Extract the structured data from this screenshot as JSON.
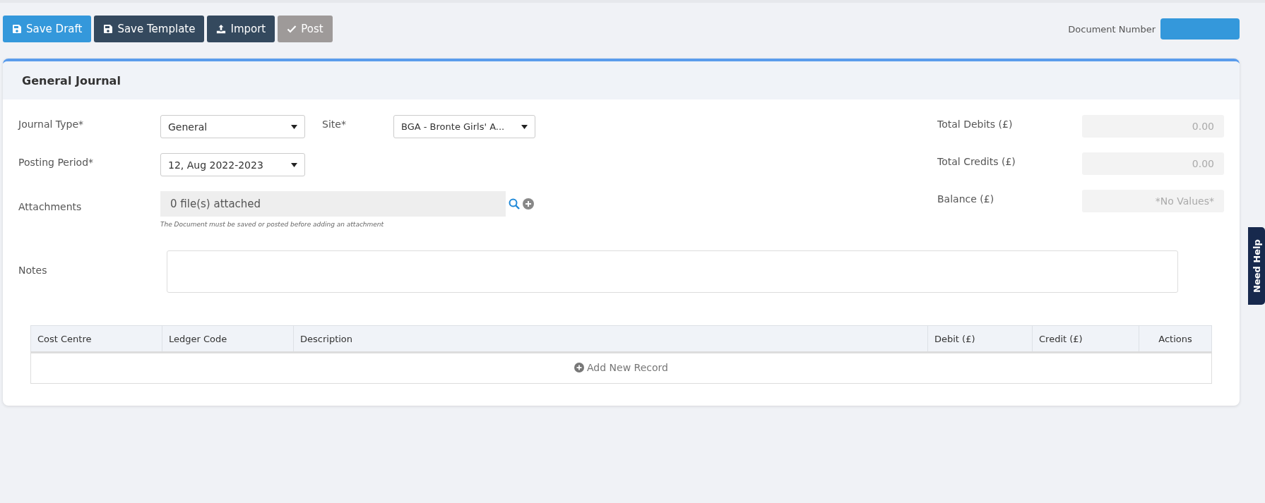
{
  "toolbar": {
    "buttons": [
      {
        "label": "Save Draft",
        "kind": "primary",
        "disabled": false
      },
      {
        "label": "Save Template",
        "kind": "dark",
        "disabled": false
      },
      {
        "label": "Import",
        "kind": "dark",
        "disabled": false
      },
      {
        "label": "Post",
        "kind": "dark",
        "disabled": true
      }
    ]
  },
  "document_number": {
    "label": "Document Number"
  },
  "card": {
    "title": "General Journal",
    "journal_type": {
      "label": "Journal Type*",
      "value": "General"
    },
    "site": {
      "label": "Site*",
      "value": "BGA - Bronte Girls' A..."
    },
    "posting_period": {
      "label": "Posting Period*",
      "value": "12, Aug 2022-2023"
    },
    "attachments": {
      "label": "Attachments",
      "value": "0 file(s) attached",
      "hint": "The Document must be saved or posted before adding an attachment"
    },
    "notes": {
      "label": "Notes"
    },
    "totals": [
      {
        "label": "Total Debits (£)",
        "value": "0.00"
      },
      {
        "label": "Total Credits (£)",
        "value": "0.00"
      },
      {
        "label": "Balance (£)",
        "value": "*No Values*"
      }
    ],
    "table": {
      "columns": [
        "Cost Centre",
        "Ledger Code",
        "Description",
        "Debit (£)",
        "Credit (£)",
        "Actions"
      ],
      "add_record": "Add New Record"
    }
  },
  "help_tab": {
    "label": "Need Help"
  }
}
